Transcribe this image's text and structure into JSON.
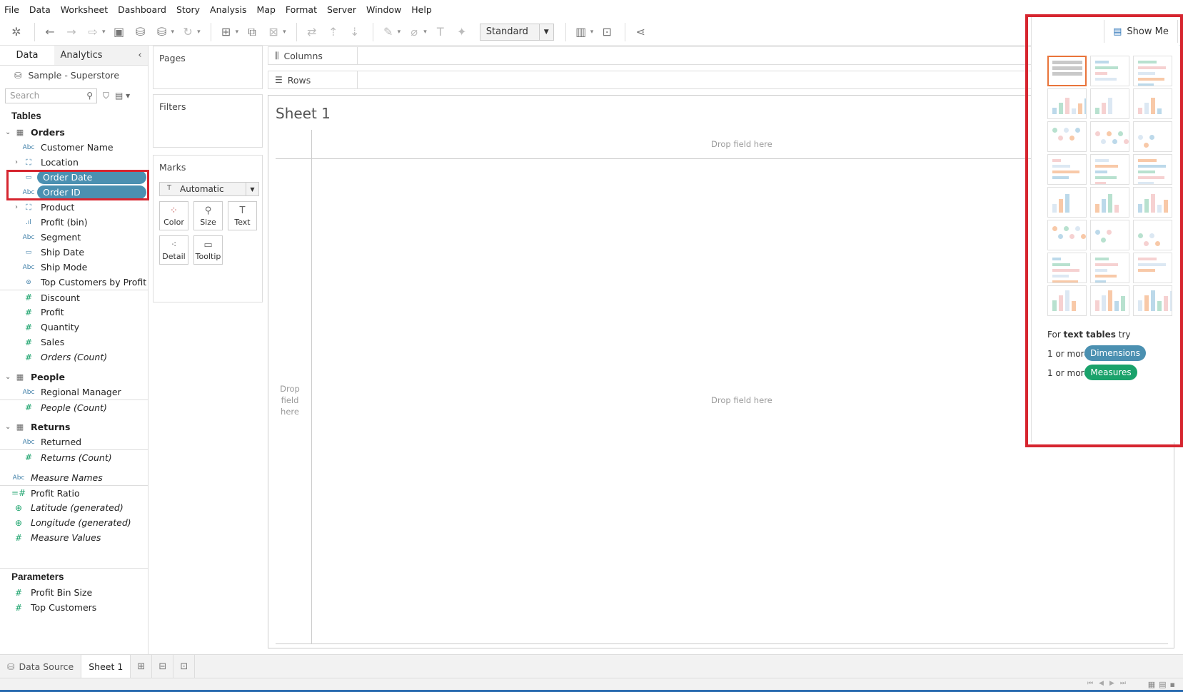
{
  "menu": [
    "File",
    "Data",
    "Worksheet",
    "Dashboard",
    "Story",
    "Analysis",
    "Map",
    "Format",
    "Server",
    "Window",
    "Help"
  ],
  "toolbar": {
    "fit_select": "Standard"
  },
  "data_pane": {
    "tabs": [
      "Data",
      "Analytics"
    ],
    "datasource": "Sample - Superstore",
    "search_placeholder": "Search",
    "tables_header": "Tables",
    "orders": {
      "name": "Orders",
      "fields": [
        {
          "type": "Abc",
          "name": "Customer Name"
        },
        {
          "type": "hier",
          "name": "Location"
        },
        {
          "type": "date",
          "name": "Order Date",
          "selected": true
        },
        {
          "type": "Abc",
          "name": "Order ID",
          "selected": true
        },
        {
          "type": "hier",
          "name": "Product"
        },
        {
          "type": "bin",
          "name": "Profit (bin)"
        },
        {
          "type": "Abc",
          "name": "Segment"
        },
        {
          "type": "date",
          "name": "Ship Date"
        },
        {
          "type": "Abc",
          "name": "Ship Mode"
        },
        {
          "type": "set",
          "name": "Top Customers by Profit"
        },
        {
          "type": "#",
          "name": "Discount"
        },
        {
          "type": "#",
          "name": "Profit"
        },
        {
          "type": "#",
          "name": "Quantity"
        },
        {
          "type": "#",
          "name": "Sales"
        },
        {
          "type": "#",
          "name": "Orders (Count)"
        }
      ]
    },
    "people": {
      "name": "People",
      "fields": [
        {
          "type": "Abc",
          "name": "Regional Manager"
        },
        {
          "type": "#",
          "name": "People (Count)"
        }
      ]
    },
    "returns": {
      "name": "Returns",
      "fields": [
        {
          "type": "Abc",
          "name": "Returned"
        },
        {
          "type": "#",
          "name": "Returns (Count)"
        }
      ]
    },
    "extra": [
      {
        "type": "Abc",
        "name": "Measure Names"
      },
      {
        "type": "=#",
        "name": "Profit Ratio"
      },
      {
        "type": "globe",
        "name": "Latitude (generated)"
      },
      {
        "type": "globe",
        "name": "Longitude (generated)"
      },
      {
        "type": "#",
        "name": "Measure Values"
      }
    ],
    "parameters_header": "Parameters",
    "parameters": [
      {
        "type": "#",
        "name": "Profit Bin Size"
      },
      {
        "type": "#",
        "name": "Top Customers"
      }
    ]
  },
  "shelves": {
    "pages": "Pages",
    "filters": "Filters",
    "marks": "Marks",
    "columns": "Columns",
    "rows": "Rows"
  },
  "marks": {
    "type": "Automatic",
    "buttons": [
      "Color",
      "Size",
      "Text",
      "Detail",
      "Tooltip"
    ]
  },
  "sheet": {
    "title": "Sheet 1",
    "drop_top": "Drop field here",
    "drop_center": "Drop field here",
    "drop_left": "Drop field here"
  },
  "show_me": {
    "button": "Show Me",
    "hint_prefix": "For ",
    "hint_bold": "text tables",
    "hint_suffix": " try",
    "req1_prefix": "1 or more",
    "req1_badge": "Dimensions",
    "req2_prefix": "1 or more",
    "req2_badge": "Measures",
    "colors": {
      "dimension": "#4b90b1",
      "measure": "#1aa26b"
    }
  },
  "bottom": {
    "datasource_tab": "Data Source",
    "sheet_tab": "Sheet 1"
  },
  "colors": {
    "accent_red": "#d6252f",
    "pill_blue": "#4b90b1"
  }
}
